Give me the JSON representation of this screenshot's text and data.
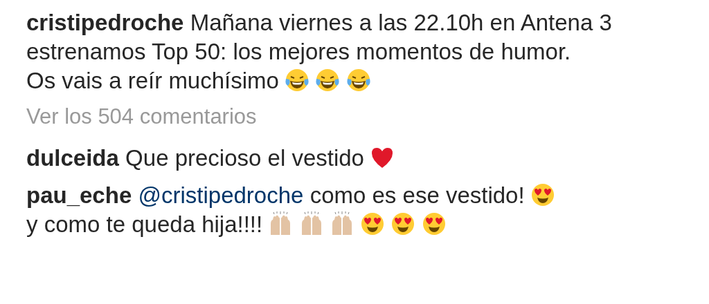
{
  "caption": {
    "username": "cristipedroche",
    "parts": [
      {
        "kind": "text",
        "text": "Mañana viernes a las 22.10h en Antena 3 estrenamos Top 50: los mejores momentos de humor."
      },
      {
        "kind": "break"
      },
      {
        "kind": "text",
        "text": "Os vais a reír muchísimo"
      },
      {
        "kind": "laugh"
      },
      {
        "kind": "laugh"
      },
      {
        "kind": "laugh"
      }
    ]
  },
  "view_all": "Ver los 504 comentarios",
  "comments": [
    {
      "username": "dulceida",
      "parts": [
        {
          "kind": "text",
          "text": "Que precioso el vestido"
        },
        {
          "kind": "heart"
        }
      ]
    },
    {
      "username": "pau_eche",
      "parts": [
        {
          "kind": "mention",
          "text": "@cristipedroche"
        },
        {
          "kind": "text",
          "text": "como es ese vestido!"
        },
        {
          "kind": "hearteyes"
        },
        {
          "kind": "break"
        },
        {
          "kind": "text",
          "text": "y como te queda hija!!!!"
        },
        {
          "kind": "hands"
        },
        {
          "kind": "hands"
        },
        {
          "kind": "hands"
        },
        {
          "kind": "hearteyes"
        },
        {
          "kind": "hearteyes"
        },
        {
          "kind": "hearteyes"
        }
      ]
    }
  ]
}
